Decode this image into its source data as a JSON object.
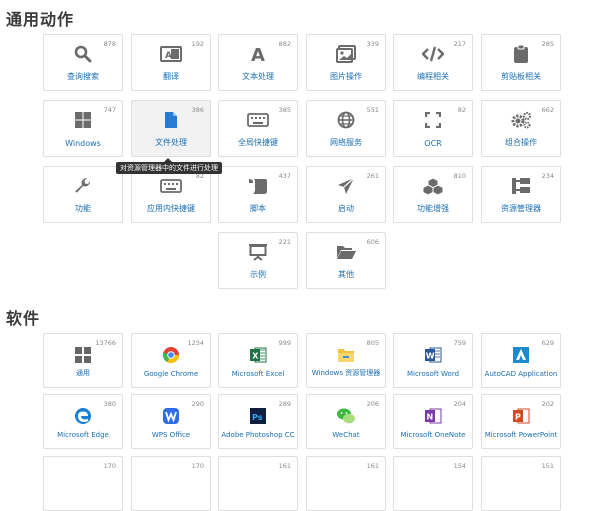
{
  "sections": {
    "actions_title": "通用动作",
    "software_title": "软件"
  },
  "actions": [
    {
      "label": "查询搜索",
      "count": "878",
      "icon": "search-icon"
    },
    {
      "label": "翻译",
      "count": "192",
      "icon": "translate-icon"
    },
    {
      "label": "文本处理",
      "count": "882",
      "icon": "text-icon"
    },
    {
      "label": "图片操作",
      "count": "339",
      "icon": "image-icon"
    },
    {
      "label": "编程相关",
      "count": "217",
      "icon": "code-icon"
    },
    {
      "label": "剪贴板相关",
      "count": "285",
      "icon": "clipboard-icon"
    },
    {
      "label": "Windows",
      "count": "747",
      "icon": "windows-icon"
    },
    {
      "label": "文件处理",
      "count": "386",
      "icon": "file-icon"
    },
    {
      "label": "全局快捷键",
      "count": "385",
      "icon": "keyboard-icon"
    },
    {
      "label": "网络服务",
      "count": "551",
      "icon": "globe-icon"
    },
    {
      "label": "OCR",
      "count": "82",
      "icon": "ocr-icon"
    },
    {
      "label": "组合操作",
      "count": "662",
      "icon": "cogs-icon"
    },
    {
      "label": "功能",
      "count": "",
      "icon": "wrench-icon"
    },
    {
      "label": "应用内快捷键",
      "count": "82",
      "icon": "keyboard-icon"
    },
    {
      "label": "脚本",
      "count": "437",
      "icon": "script-icon"
    },
    {
      "label": "启动",
      "count": "261",
      "icon": "send-icon"
    },
    {
      "label": "功能增强",
      "count": "810",
      "icon": "cubes-icon"
    },
    {
      "label": "资源管理器",
      "count": "234",
      "icon": "tree-icon"
    },
    {
      "label": "示例",
      "count": "221",
      "icon": "presentation-icon"
    },
    {
      "label": "其他",
      "count": "606",
      "icon": "folder-open-icon"
    }
  ],
  "tooltip": "对资源管理器中的文件进行处理",
  "software": [
    {
      "label": "通用",
      "count": "13766",
      "icon": "grid-icon",
      "color": "#666666"
    },
    {
      "label": "Google Chrome",
      "count": "1234",
      "icon": "chrome-icon",
      "color": "#e34133"
    },
    {
      "label": "Microsoft Excel",
      "count": "999",
      "icon": "excel-icon",
      "color": "#1f7244"
    },
    {
      "label": "Windows 资源管理器",
      "count": "805",
      "icon": "explorer-icon",
      "color": "#f3c140"
    },
    {
      "label": "Microsoft Word",
      "count": "759",
      "icon": "word-icon",
      "color": "#2b579a"
    },
    {
      "label": "AutoCAD Application",
      "count": "629",
      "icon": "autocad-icon",
      "color": "#1d8bd0"
    },
    {
      "label": "Microsoft Edge",
      "count": "380",
      "icon": "edge-icon",
      "color": "#1c7fd6"
    },
    {
      "label": "WPS Office",
      "count": "290",
      "icon": "wps-icon",
      "color": "#2f6cea"
    },
    {
      "label": "Adobe Photoshop CC",
      "count": "289",
      "icon": "photoshop-icon",
      "color": "#0f1f3d"
    },
    {
      "label": "WeChat",
      "count": "206",
      "icon": "wechat-icon",
      "color": "#3bb83f"
    },
    {
      "label": "Microsoft OneNote",
      "count": "204",
      "icon": "onenote-icon",
      "color": "#7b3aa6"
    },
    {
      "label": "Microsoft PowerPoint",
      "count": "202",
      "icon": "powerpoint-icon",
      "color": "#d24726"
    },
    {
      "label": "",
      "count": "170",
      "icon": "",
      "color": ""
    },
    {
      "label": "",
      "count": "170",
      "icon": "",
      "color": ""
    },
    {
      "label": "",
      "count": "161",
      "icon": "",
      "color": ""
    },
    {
      "label": "",
      "count": "161",
      "icon": "",
      "color": ""
    },
    {
      "label": "",
      "count": "154",
      "icon": "",
      "color": ""
    },
    {
      "label": "",
      "count": "151",
      "icon": "",
      "color": ""
    }
  ]
}
